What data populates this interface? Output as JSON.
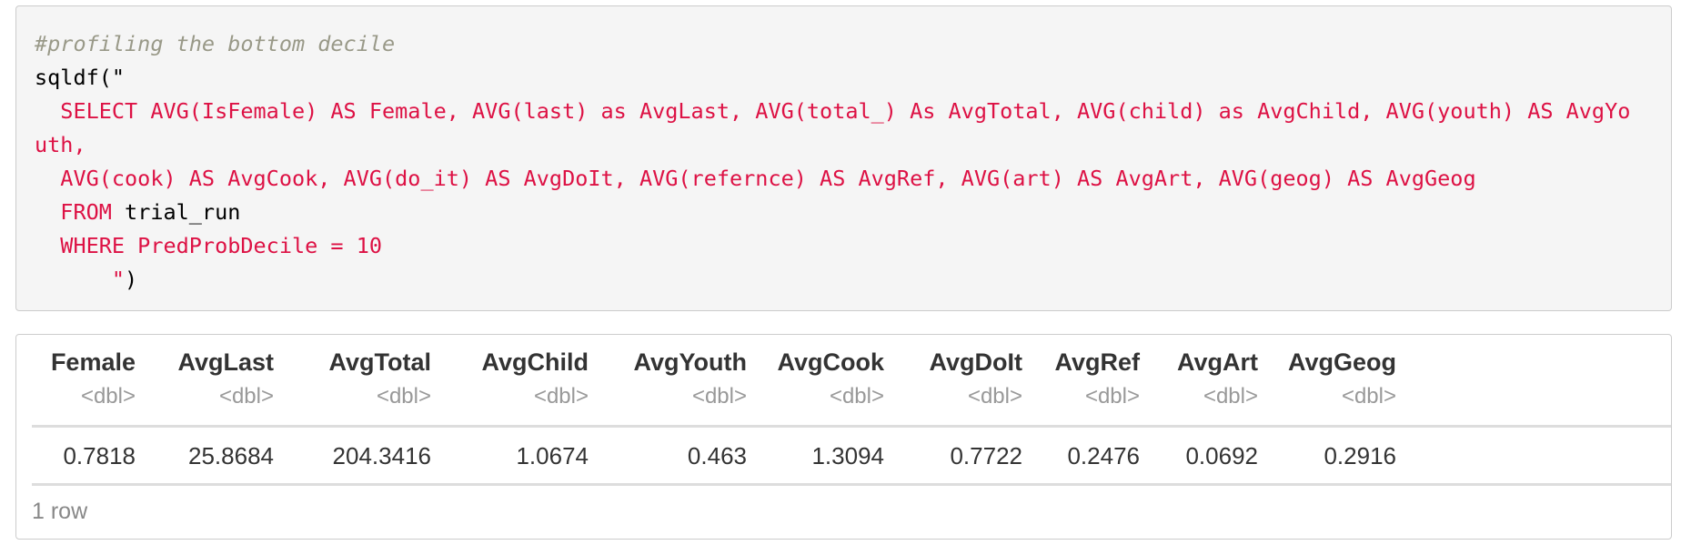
{
  "code": {
    "comment": "#profiling the bottom decile",
    "call_open": "sqldf(\"",
    "sql_line1a": "  SELECT AVG(IsFemale) AS Female, AVG(last) as AvgLast, AVG(total_) As AvgTotal, AVG(child) as AvgChild, AVG(youth) AS AvgYo",
    "sql_line1b": "uth,",
    "sql_line2": "  AVG(cook) AS AvgCook, AVG(do_it) AS AvgDoIt, AVG(refernce) AS AvgRef, AVG(art) AS AvgArt, AVG(geog) AS AvgGeog",
    "sql_line3a": "  FROM ",
    "sql_line3b": "trial_run",
    "sql_line4": "  WHERE PredProbDecile = 10",
    "call_close_quote": "      \"",
    "call_close_paren": ")"
  },
  "table": {
    "columns": [
      {
        "name": "Female",
        "type": "<dbl>"
      },
      {
        "name": "AvgLast",
        "type": "<dbl>"
      },
      {
        "name": "AvgTotal",
        "type": "<dbl>"
      },
      {
        "name": "AvgChild",
        "type": "<dbl>"
      },
      {
        "name": "AvgYouth",
        "type": "<dbl>"
      },
      {
        "name": "AvgCook",
        "type": "<dbl>"
      },
      {
        "name": "AvgDoIt",
        "type": "<dbl>"
      },
      {
        "name": "AvgRef",
        "type": "<dbl>"
      },
      {
        "name": "AvgArt",
        "type": "<dbl>"
      },
      {
        "name": "AvgGeog",
        "type": "<dbl>"
      }
    ],
    "rows": [
      [
        "0.7818",
        "25.8684",
        "204.3416",
        "1.0674",
        "0.463",
        "1.3094",
        "0.7722",
        "0.2476",
        "0.0692",
        "0.2916"
      ]
    ],
    "footer": "1 row"
  },
  "colors": {
    "code_background": "#f5f5f5",
    "comment": "#999988",
    "string": "#dd1144",
    "header_text": "#333333",
    "type_text": "#999999",
    "rule": "#dddddd"
  }
}
